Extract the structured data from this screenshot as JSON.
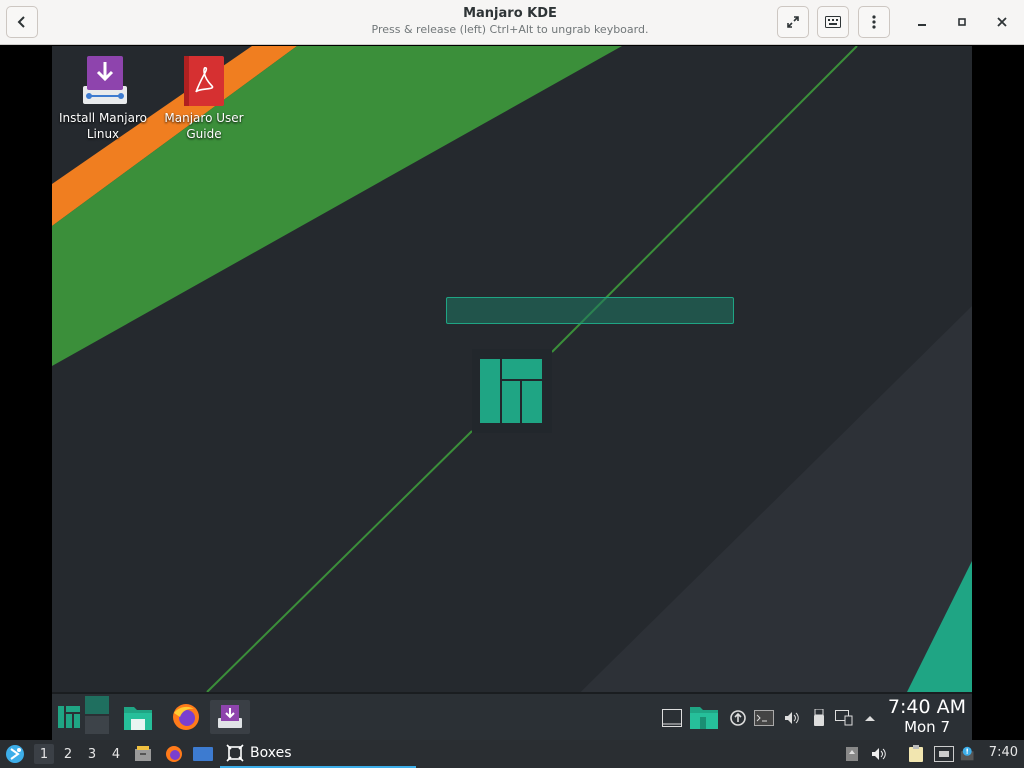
{
  "header": {
    "title": "Manjaro KDE",
    "subtitle": "Press & release (left) Ctrl+Alt to ungrab keyboard.",
    "back_icon": "chevron-left-icon",
    "fullscreen_icon": "expand-icon",
    "keyboard_icon": "keyboard-icon",
    "menu_icon": "kebab-menu-icon",
    "minimize_icon": "minimize-icon",
    "maximize_icon": "maximize-icon",
    "close_icon": "close-icon"
  },
  "desktop": {
    "icons": [
      {
        "label": "Install Manjaro Linux",
        "icon": "installer-icon"
      },
      {
        "label": "Manjaro User Guide",
        "icon": "pdf-document-icon"
      }
    ],
    "colors": {
      "orange": "#f07e20",
      "green": "#3b8f3a",
      "teal": "#1fa584",
      "dark": "#25292e"
    }
  },
  "vm_panel": {
    "launchers": [
      "manjaro-menu-icon",
      "show-desktop-icon",
      "file-manager-icon",
      "firefox-icon",
      "installer-icon"
    ],
    "tray": [
      "window-icon",
      "folder-icon",
      "update-icon",
      "terminal-icon",
      "volume-icon",
      "usb-icon",
      "network-icon",
      "expand-tray-icon"
    ],
    "clock_time": "7:40 AM",
    "clock_date": "Mon 7"
  },
  "host_bar": {
    "workspaces": [
      "1",
      "2",
      "3",
      "4"
    ],
    "active_workspace": "1",
    "task_label": "Boxes",
    "clock": "7:40"
  }
}
